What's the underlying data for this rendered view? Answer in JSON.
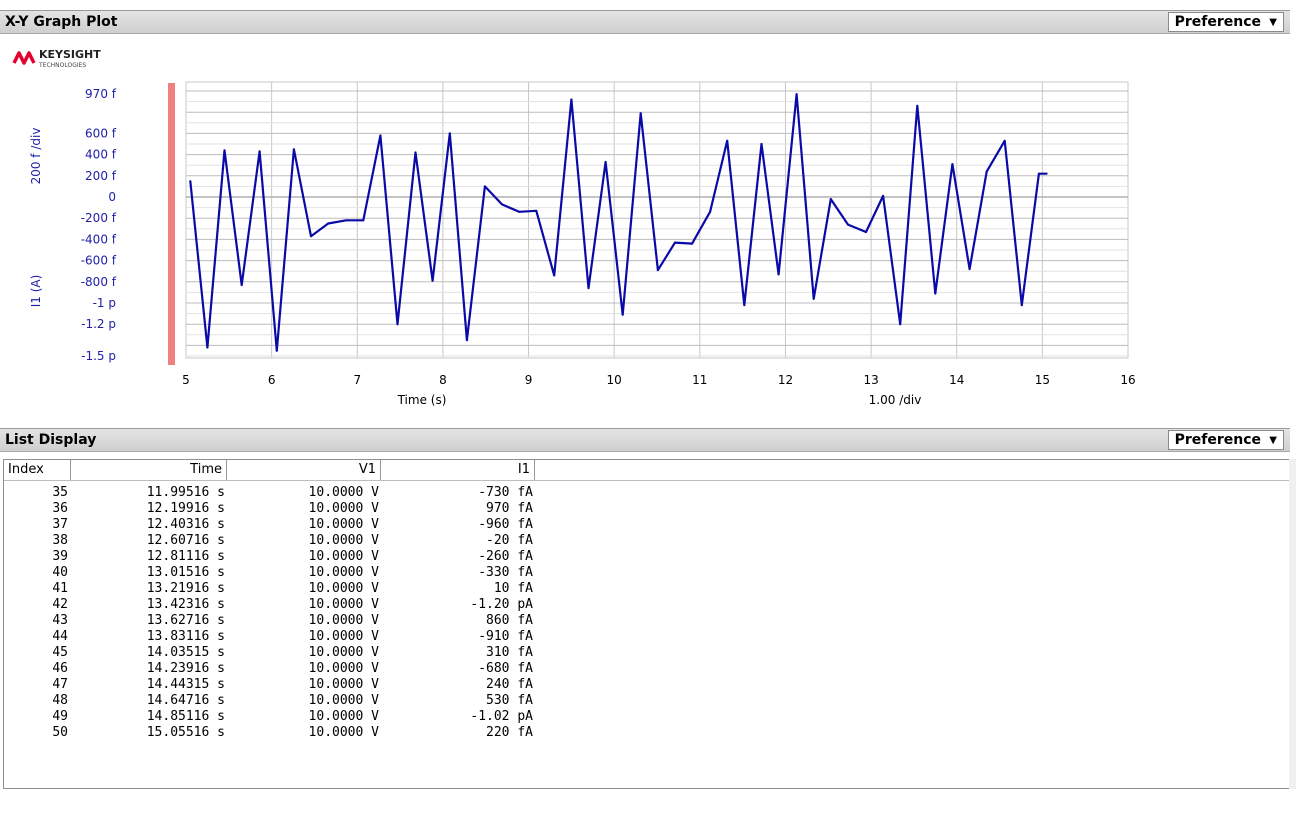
{
  "graph_panel": {
    "title": "X-Y Graph Plot",
    "preference_label": "Preference",
    "preference_arrow": "▼"
  },
  "logo": {
    "text": "KEYSIGHT",
    "subtext": "TECHNOLOGIES",
    "color": "#e4002b"
  },
  "list_panel": {
    "title": "List Display",
    "preference_label": "Preference",
    "preference_arrow": "▼"
  },
  "colors": {
    "trace": "#0a0aa8",
    "grid": "#c8c8c8",
    "axis_text": "#1e1ea8",
    "marker": "#f08080"
  },
  "chart_data": {
    "type": "line",
    "xlabel": "Time (s)",
    "ylabel": "I1 (A)",
    "y_scale_label": "200 f /div",
    "x_scale_label": "1.00  /div",
    "xlim": [
      5,
      16
    ],
    "x_ticks": [
      5,
      6,
      7,
      8,
      9,
      10,
      11,
      12,
      13,
      14,
      15,
      16
    ],
    "y_ticks": [
      {
        "v": 9.7e-13,
        "label": "970 f"
      },
      {
        "v": 6e-13,
        "label": "600 f"
      },
      {
        "v": 4e-13,
        "label": "400 f"
      },
      {
        "v": 2e-13,
        "label": "200 f"
      },
      {
        "v": 0,
        "label": "0"
      },
      {
        "v": -2e-13,
        "label": "-200 f"
      },
      {
        "v": -4e-13,
        "label": "-400 f"
      },
      {
        "v": -6e-13,
        "label": "-600 f"
      },
      {
        "v": -8e-13,
        "label": "-800 f"
      },
      {
        "v": -1e-12,
        "label": "-1 p"
      },
      {
        "v": -1.2e-12,
        "label": "-1.2 p"
      },
      {
        "v": -1.5e-12,
        "label": "-1.5 p"
      }
    ],
    "grid": true,
    "series": [
      {
        "x": [
          5.05,
          5.25,
          5.45,
          5.65,
          5.86,
          6.06,
          6.26,
          6.46,
          6.66,
          6.87,
          7.07,
          7.27,
          7.47,
          7.68,
          7.88,
          8.08,
          8.28,
          8.49,
          8.69,
          8.89,
          9.09,
          9.3,
          9.5,
          9.7,
          9.9,
          10.1,
          10.31,
          10.51,
          10.71,
          10.91,
          11.12,
          11.32,
          11.52,
          11.72,
          11.92,
          12.13,
          12.33,
          12.53,
          12.73,
          12.94,
          13.14,
          13.34,
          13.54,
          13.75,
          13.95,
          14.15,
          14.35,
          14.56,
          14.76,
          14.96,
          15.05
        ],
        "y": [
          1.5e-13,
          -1.42e-12,
          4.4e-13,
          -8.3e-13,
          4.3e-13,
          -1.45e-12,
          4.5e-13,
          -3.7e-13,
          -2.5e-13,
          -2.2e-13,
          -2.2e-13,
          5.8e-13,
          -1.2e-12,
          4.2e-13,
          -7.9e-13,
          6e-13,
          -1.35e-12,
          1e-13,
          -7e-14,
          -1.4e-13,
          -1.3e-13,
          -7.4e-13,
          9.2e-13,
          -8.6e-13,
          3.3e-13,
          -1.11e-12,
          7.9e-13,
          -6.9e-13,
          -4.3e-13,
          -4.4e-13,
          -1.4e-13,
          5.3e-13,
          -1.02e-12,
          5e-13,
          -7.3e-13,
          9.7e-13,
          -9.6e-13,
          -2e-14,
          -2.6e-13,
          -3.3e-13,
          1e-14,
          -1.2e-12,
          8.6e-13,
          -9.1e-13,
          3.1e-13,
          -6.8e-13,
          2.4e-13,
          5.3e-13,
          -1.02e-12,
          2.2e-13,
          2.2e-13
        ]
      }
    ]
  },
  "list": {
    "columns": [
      "Index",
      "Time",
      "V1",
      "I1"
    ],
    "rows": [
      [
        "35",
        "11.99516 s",
        "10.0000 V",
        "-730 fA"
      ],
      [
        "36",
        "12.19916 s",
        "10.0000 V",
        "970 fA"
      ],
      [
        "37",
        "12.40316 s",
        "10.0000 V",
        "-960 fA"
      ],
      [
        "38",
        "12.60716 s",
        "10.0000 V",
        "-20 fA"
      ],
      [
        "39",
        "12.81116 s",
        "10.0000 V",
        "-260 fA"
      ],
      [
        "40",
        "13.01516 s",
        "10.0000 V",
        "-330 fA"
      ],
      [
        "41",
        "13.21916 s",
        "10.0000 V",
        "10 fA"
      ],
      [
        "42",
        "13.42316 s",
        "10.0000 V",
        "-1.20 pA"
      ],
      [
        "43",
        "13.62716 s",
        "10.0000 V",
        "860 fA"
      ],
      [
        "44",
        "13.83116 s",
        "10.0000 V",
        "-910 fA"
      ],
      [
        "45",
        "14.03515 s",
        "10.0000 V",
        "310 fA"
      ],
      [
        "46",
        "14.23916 s",
        "10.0000 V",
        "-680 fA"
      ],
      [
        "47",
        "14.44315 s",
        "10.0000 V",
        "240 fA"
      ],
      [
        "48",
        "14.64716 s",
        "10.0000 V",
        "530 fA"
      ],
      [
        "49",
        "14.85116 s",
        "10.0000 V",
        "-1.02 pA"
      ],
      [
        "50",
        "15.05516 s",
        "10.0000 V",
        "220 fA"
      ]
    ]
  }
}
